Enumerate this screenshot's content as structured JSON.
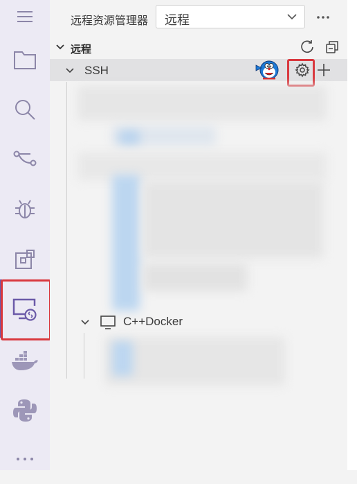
{
  "activity_bar": {
    "icons": [
      {
        "name": "menu-icon"
      },
      {
        "name": "explorer-icon"
      },
      {
        "name": "search-icon"
      },
      {
        "name": "source-control-icon"
      },
      {
        "name": "debug-icon"
      },
      {
        "name": "extensions-icon"
      },
      {
        "name": "remote-explorer-icon",
        "active": true
      },
      {
        "name": "docker-icon"
      },
      {
        "name": "python-icon"
      },
      {
        "name": "more-icon"
      }
    ],
    "active_color": "#6b5aa8",
    "highlight_color": "#d9383e"
  },
  "sidebar": {
    "title": "远程资源管理器",
    "selector": {
      "value": "远程"
    },
    "section_title": "远程",
    "ssh_group": {
      "label": "SSH"
    },
    "docker_host": {
      "label": "C++Docker"
    }
  }
}
